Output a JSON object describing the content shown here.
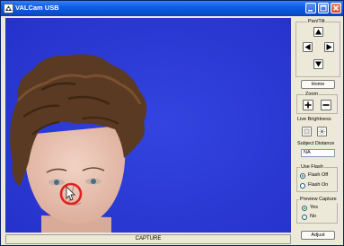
{
  "window": {
    "title": "VALCam USB",
    "icons": {
      "app": "camera-app-icon",
      "minimize": "minimize-icon",
      "maximize": "maximize-icon",
      "close": "close-icon"
    }
  },
  "preview": {
    "background_color": "#2a36d8",
    "subject": "mannequin head",
    "cursor_icon": "mouse-cursor-icon",
    "focus_marker_color": "#e02020"
  },
  "capture": {
    "label": "CAPTURE"
  },
  "pan_tilt": {
    "label": "Pan/Tilt",
    "icons": {
      "up": "arrow-up-icon",
      "left": "arrow-left-icon",
      "right": "arrow-right-icon",
      "down": "arrow-down-icon"
    }
  },
  "home": {
    "label": "Home"
  },
  "zoom": {
    "label": "Zoom",
    "icons": {
      "in": "plus-icon",
      "out": "minus-icon"
    }
  },
  "live_brightness": {
    "label": "Live Brightness",
    "icons": {
      "dim": "brightness-low-icon",
      "bright": "brightness-high-icon"
    }
  },
  "subject_distance": {
    "label": "Subject Distance",
    "value": "NA"
  },
  "use_flash": {
    "label": "Use Flash",
    "options": [
      {
        "label": "Flash Off",
        "selected": true
      },
      {
        "label": "Flash On",
        "selected": false
      }
    ]
  },
  "preview_capture": {
    "label": "Preview Capture",
    "options": [
      {
        "label": "Yes",
        "selected": true
      },
      {
        "label": "No",
        "selected": false
      }
    ]
  },
  "adjust": {
    "label": "Adjust"
  }
}
